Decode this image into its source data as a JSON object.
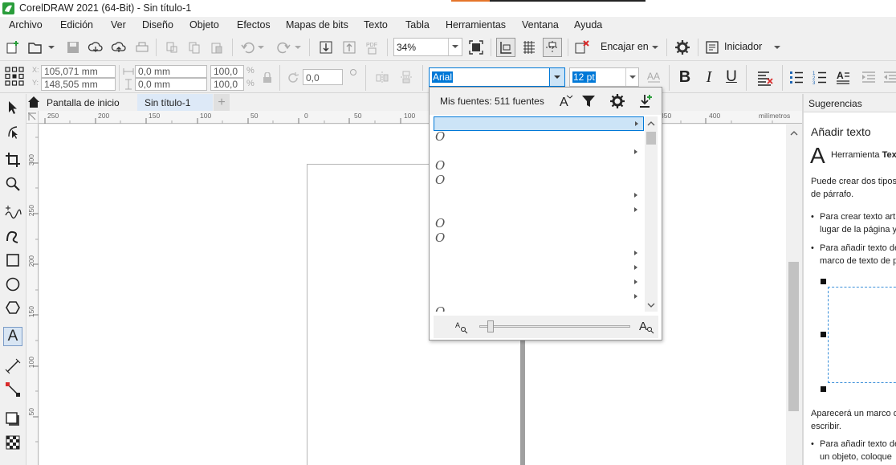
{
  "window": {
    "title": "CorelDRAW 2021 (64-Bit) - Sin título-1"
  },
  "menu": {
    "items": [
      "Archivo",
      "Edición",
      "Ver",
      "Diseño",
      "Objeto",
      "Efectos",
      "Mapas de bits",
      "Texto",
      "Tabla",
      "Herramientas",
      "Ventana",
      "Ayuda"
    ]
  },
  "standard_toolbar": {
    "zoom_value": "34%",
    "snap_label": "Encajar en",
    "launcher_label": "Iniciador"
  },
  "property_bar": {
    "x_value": "105,071 mm",
    "y_value": "148,505 mm",
    "width_value": "0,0 mm",
    "height_value": "0,0 mm",
    "scale_x": "100,0",
    "scale_y": "100,0",
    "percent_symbol": "%",
    "rotation_value": "0,0",
    "font_name": "Arial",
    "font_size": "12 pt"
  },
  "tabs": {
    "home": "Pantalla de inicio",
    "document": "Sin título-1"
  },
  "ruler": {
    "unit": "milímetros",
    "h_ticks": [
      "250",
      "200",
      "150",
      "100",
      "50",
      "0",
      "50",
      "100",
      "350",
      "400"
    ],
    "v_ticks": [
      "300",
      "250",
      "200",
      "150",
      "100",
      "50"
    ]
  },
  "font_dropdown": {
    "header": "Mis fuentes: 511 fuentes"
  },
  "docker": {
    "title": "Sugerencias",
    "heading": "Añadir texto",
    "tool_prefix": "Herramienta ",
    "tool_name": "Tex",
    "intro_line1": "Puede crear dos tipos",
    "intro_line2": "de párrafo.",
    "bullet1_line1": "Para crear texto artí",
    "bullet1_line2": "lugar de la página y",
    "bullet2_line1": "Para añadir texto de",
    "bullet2_line2": "marco de texto de p",
    "outro_line1": "Aparecerá un marco d",
    "outro_line2": "escribir.",
    "bullet3_line1": "Para añadir texto de",
    "bullet3_line2": "un objeto, coloque"
  },
  "colors": {
    "accent": "#0078d7",
    "selection": "#cce4f7",
    "tab_active": "#dde9f7"
  }
}
